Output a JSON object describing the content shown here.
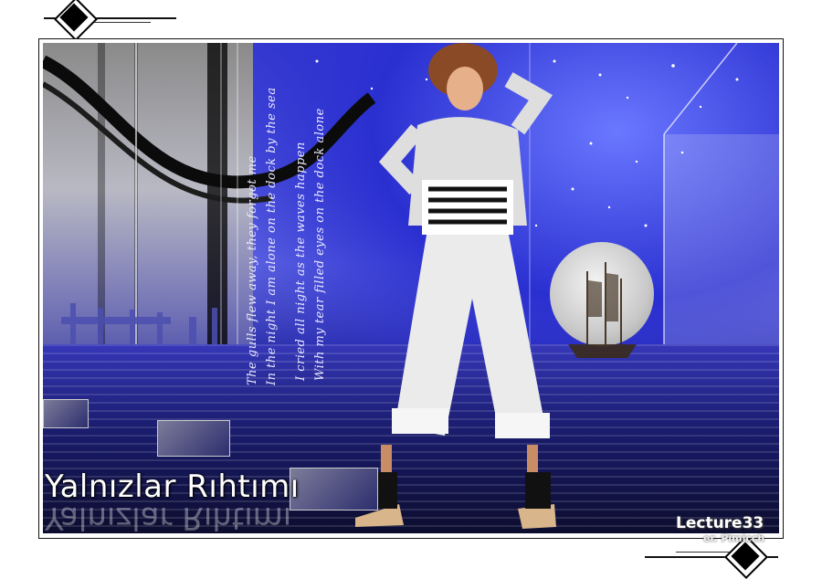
{
  "artwork": {
    "title": "Yalnızlar Rıhtımı",
    "watermark": "Lecture33",
    "watermark_sub": "er. Pimicch",
    "poem_lines": [
      "The gulls flew away, they forgot me",
      "In the night I am alone on the dock by the sea",
      "I cried all night as the waves happen",
      "With my tear filled eyes on the dock alone"
    ]
  },
  "colors": {
    "primary_blue": "#3b3ecf",
    "deep_blue": "#10123e",
    "frame_border": "#111111",
    "background": "#ffffff"
  }
}
